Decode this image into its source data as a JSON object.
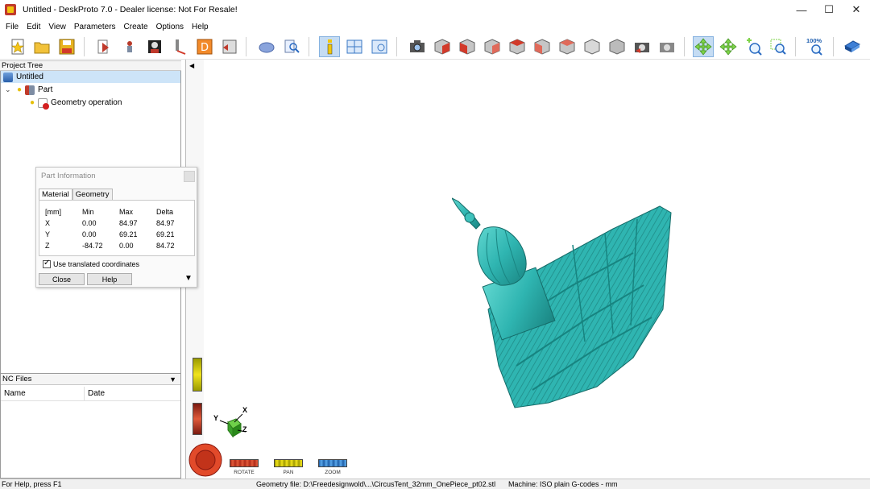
{
  "window": {
    "title": "Untitled - DeskProto 7.0 - Dealer license: Not For Resale!",
    "minimize": "—",
    "maximize": "☐",
    "close": "✕"
  },
  "menu": [
    "File",
    "Edit",
    "View",
    "Parameters",
    "Create",
    "Options",
    "Help"
  ],
  "toolbar": {
    "zoom_label": "100%"
  },
  "project_tree": {
    "header": "Project Tree",
    "root": "Untitled",
    "part": "Part",
    "operation": "Geometry operation"
  },
  "nc_files": {
    "header": "NC Files",
    "col_name": "Name",
    "col_date": "Date"
  },
  "part_info": {
    "title": "Part Information",
    "tabs": [
      "Material",
      "Geometry"
    ],
    "headers": [
      "[mm]",
      "Min",
      "Max",
      "Delta"
    ],
    "rows": [
      [
        "X",
        "0.00",
        "84.97",
        "84.97"
      ],
      [
        "Y",
        "0.00",
        "69.21",
        "69.21"
      ],
      [
        "Z",
        "-84.72",
        "0.00",
        "84.72"
      ]
    ],
    "checkbox_label": "Use translated coordinates",
    "close_button": "Close",
    "help_button": "Help"
  },
  "axes": {
    "x": "X",
    "y": "Y",
    "z": "Z"
  },
  "nav": {
    "rotate": "ROTATE",
    "pan": "PAN",
    "zoom": "ZOOM"
  },
  "status": {
    "help": "For Help, press F1",
    "geometry": "Geometry file: D:\\Freedesignwold\\...\\CircusTent_32mm_OnePiece_pt02.stl",
    "machine": "Machine: ISO plain G-codes - mm"
  },
  "colors": {
    "model": "#2fb5b1",
    "selection": "#cde4f8",
    "rotate": "#d63a2a",
    "pan": "#e8d21c",
    "zoom": "#3b8fd9"
  }
}
